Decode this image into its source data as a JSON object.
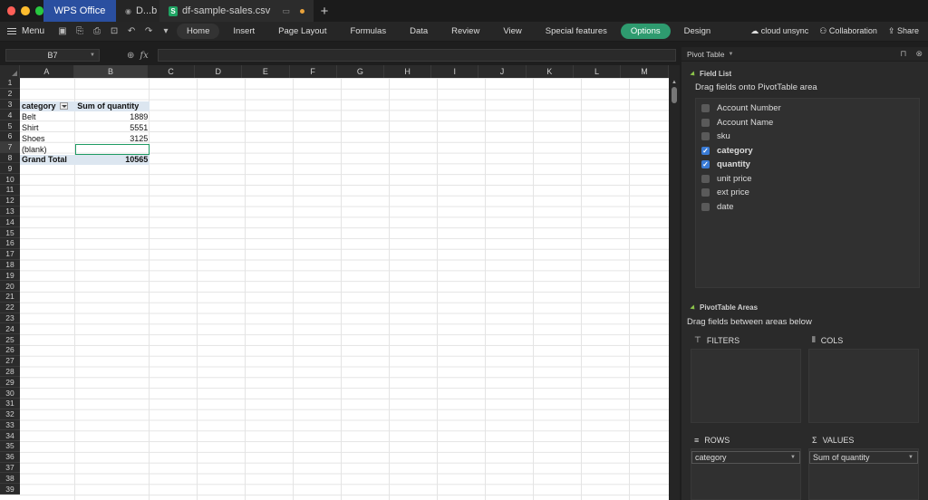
{
  "tabs": {
    "app": "WPS Office",
    "doc": "D...b",
    "file": "df-sample-sales.csv"
  },
  "menu": {
    "menu_label": "Menu",
    "items": [
      "Home",
      "Insert",
      "Page Layout",
      "Formulas",
      "Data",
      "Review",
      "View",
      "Special features",
      "Options",
      "Design"
    ],
    "right": {
      "sync": "cloud unsync",
      "collab": "Collaboration",
      "share": "Share"
    }
  },
  "formula": {
    "cell_ref": "B7",
    "fx": "fx"
  },
  "grid": {
    "columns": [
      "A",
      "B",
      "C",
      "D",
      "E",
      "F",
      "G",
      "H",
      "I",
      "J",
      "K",
      "L",
      "M"
    ],
    "rows": [
      "1",
      "2",
      "3",
      "4",
      "5",
      "6",
      "7",
      "8",
      "9",
      "10",
      "11",
      "12",
      "13",
      "14",
      "15",
      "16",
      "17",
      "18",
      "19",
      "20",
      "21",
      "22",
      "23",
      "24",
      "25",
      "26",
      "27",
      "28",
      "29",
      "30",
      "31",
      "32",
      "33",
      "34",
      "35",
      "36",
      "37",
      "38",
      "39"
    ]
  },
  "pivot": {
    "header_category": "category",
    "header_sum": "Sum of quantity",
    "rows": [
      {
        "label": "Belt",
        "value": "1889"
      },
      {
        "label": "Shirt",
        "value": "5551"
      },
      {
        "label": "Shoes",
        "value": "3125"
      },
      {
        "label": "(blank)",
        "value": ""
      }
    ],
    "total_label": "Grand Total",
    "total_value": "10565"
  },
  "panel": {
    "title": "Pivot Table",
    "field_list_title": "Field List",
    "field_list_hint": "Drag fields onto PivotTable area",
    "fields": [
      {
        "name": "Account Number",
        "checked": false
      },
      {
        "name": "Account Name",
        "checked": false
      },
      {
        "name": "sku",
        "checked": false
      },
      {
        "name": "category",
        "checked": true
      },
      {
        "name": "quantity",
        "checked": true
      },
      {
        "name": "unit price",
        "checked": false
      },
      {
        "name": "ext price",
        "checked": false
      },
      {
        "name": "date",
        "checked": false
      }
    ],
    "areas_title": "PivotTable Areas",
    "areas_hint": "Drag fields between areas below",
    "filters": "FILTERS",
    "cols": "COLS",
    "rows": "ROWS",
    "values": "VALUES",
    "rows_item": "category",
    "values_item": "Sum of quantity"
  }
}
